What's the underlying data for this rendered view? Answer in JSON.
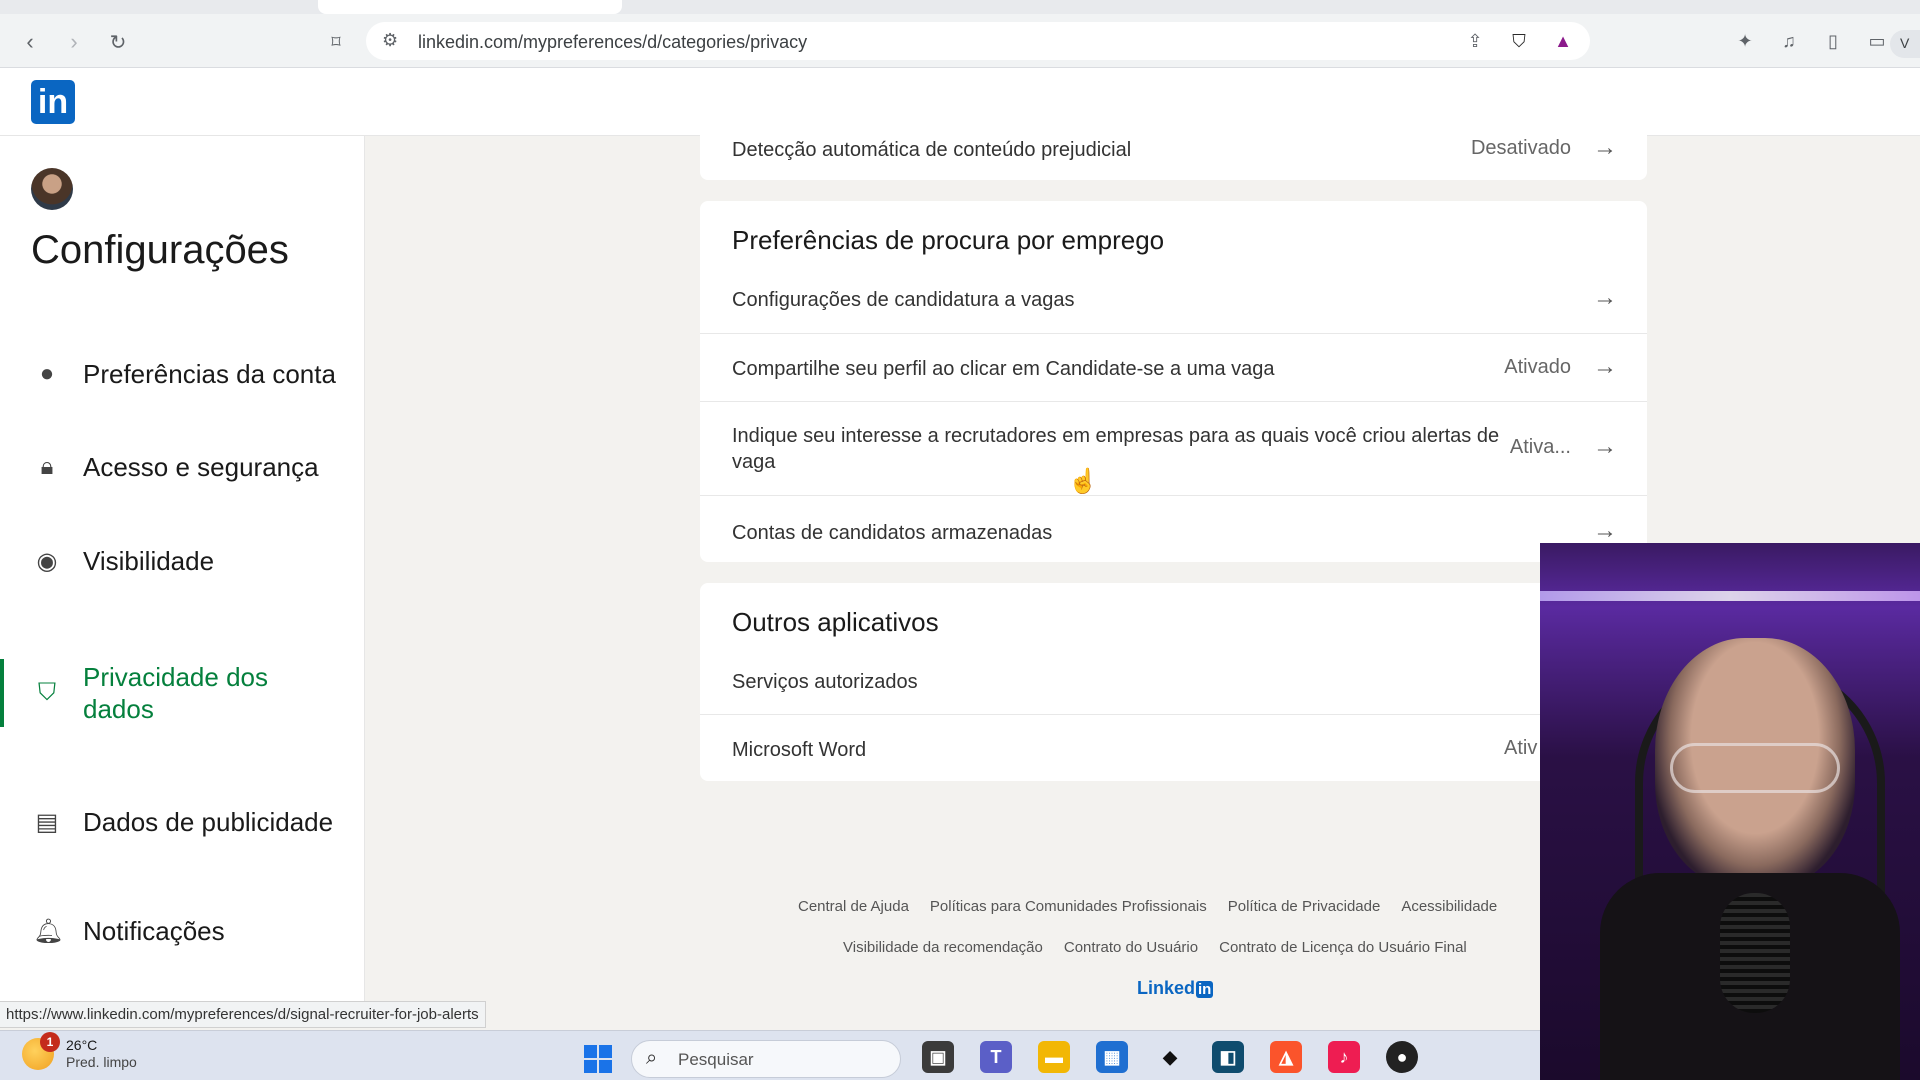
{
  "browser": {
    "url": "linkedin.com/mypreferences/d/categories/privacy",
    "vpn_label": "V"
  },
  "sidebar": {
    "title": "Configurações",
    "items": [
      {
        "label": "Preferências da conta",
        "icon": "person-icon"
      },
      {
        "label": "Acesso e segurança",
        "icon": "lock-icon"
      },
      {
        "label": "Visibilidade",
        "icon": "eye-icon"
      },
      {
        "label": "Privacidade dos dados",
        "icon": "shield-icon",
        "active": true
      },
      {
        "label": "Dados de publicidade",
        "icon": "newspaper-icon"
      },
      {
        "label": "Notificações",
        "icon": "bell-icon"
      }
    ]
  },
  "main": {
    "top_row": {
      "label": "Detecção automática de conteúdo prejudicial",
      "value": "Desativado"
    },
    "job_prefs": {
      "title": "Preferências de procura por emprego",
      "rows": [
        {
          "label": "Configurações de candidatura a vagas",
          "value": ""
        },
        {
          "label": "Compartilhe seu perfil ao clicar em Candidate-se a uma vaga",
          "value": "Ativado"
        },
        {
          "label": "Indique seu interesse a recrutadores em empresas para as quais você criou alertas de vaga",
          "value": "Ativa..."
        },
        {
          "label": "Contas de candidatos armazenadas",
          "value": ""
        }
      ]
    },
    "other_apps": {
      "title": "Outros aplicativos",
      "rows": [
        {
          "label": "Serviços autorizados",
          "value": ""
        },
        {
          "label": "Microsoft Word",
          "value": "Ativ"
        }
      ]
    }
  },
  "footer": {
    "line1": [
      "Central de Ajuda",
      "Políticas para Comunidades Profissionais",
      "Política de Privacidade",
      "Acessibilidade"
    ],
    "line2": [
      "Visibilidade da recomendação",
      "Contrato do Usuário",
      "Contrato de Licença do Usuário Final"
    ],
    "brand": "Linked",
    "brand_in": "in"
  },
  "status_url": "https://www.linkedin.com/mypreferences/d/signal-recruiter-for-job-alerts",
  "taskbar": {
    "weather_temp": "26°C",
    "weather_desc": "Pred. limpo",
    "weather_badge": "1",
    "search_placeholder": "Pesquisar"
  },
  "colors": {
    "linkedin_blue": "#0a66c2",
    "active_green": "#05803d"
  }
}
